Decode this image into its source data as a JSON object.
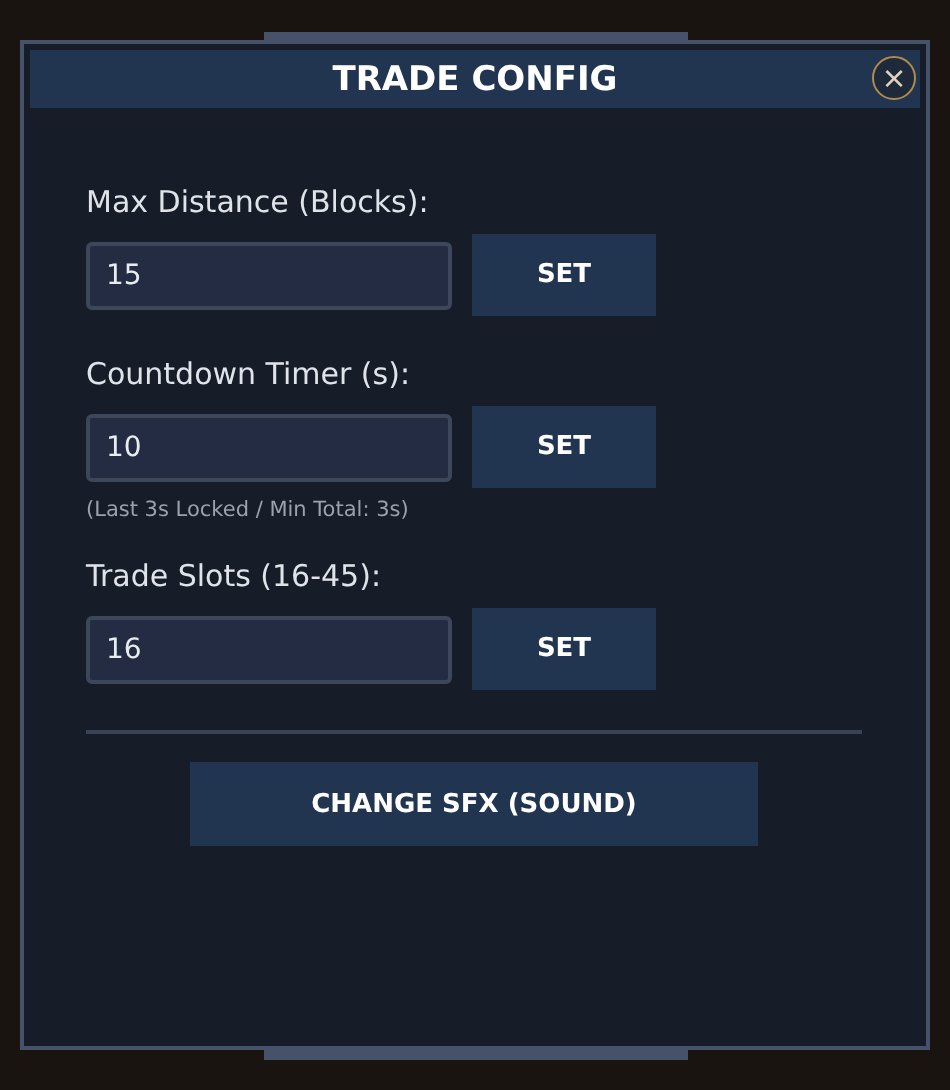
{
  "window": {
    "title": "TRADE CONFIG",
    "close": "×"
  },
  "settings": [
    {
      "label": "Max Distance (Blocks):",
      "value": "15",
      "button": "SET"
    },
    {
      "label": "Countdown Timer (s):",
      "value": "10",
      "button": "SET",
      "note": "(Last 3s Locked / Min Total: 3s)"
    },
    {
      "label": "Trade Slots (16-45):",
      "value": "16",
      "button": "SET"
    }
  ],
  "action_button": "CHANGE SFX (SOUND)"
}
